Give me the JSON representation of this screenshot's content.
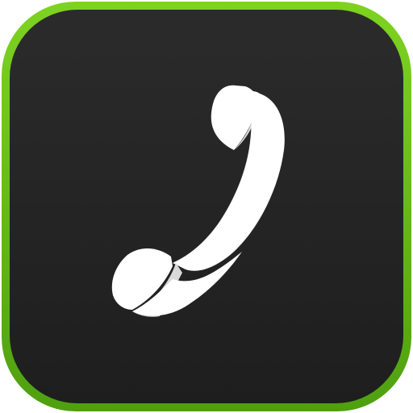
{
  "app_icon": {
    "icon": "phone-handset-icon",
    "colors": {
      "border_light": "#7ed321",
      "border_dark": "#4fa010",
      "tile_top": "#2b2b2b",
      "tile_bottom": "#1e1e1e",
      "glyph": "#ffffff",
      "glyph_shadow": "#d9d9d9"
    }
  }
}
